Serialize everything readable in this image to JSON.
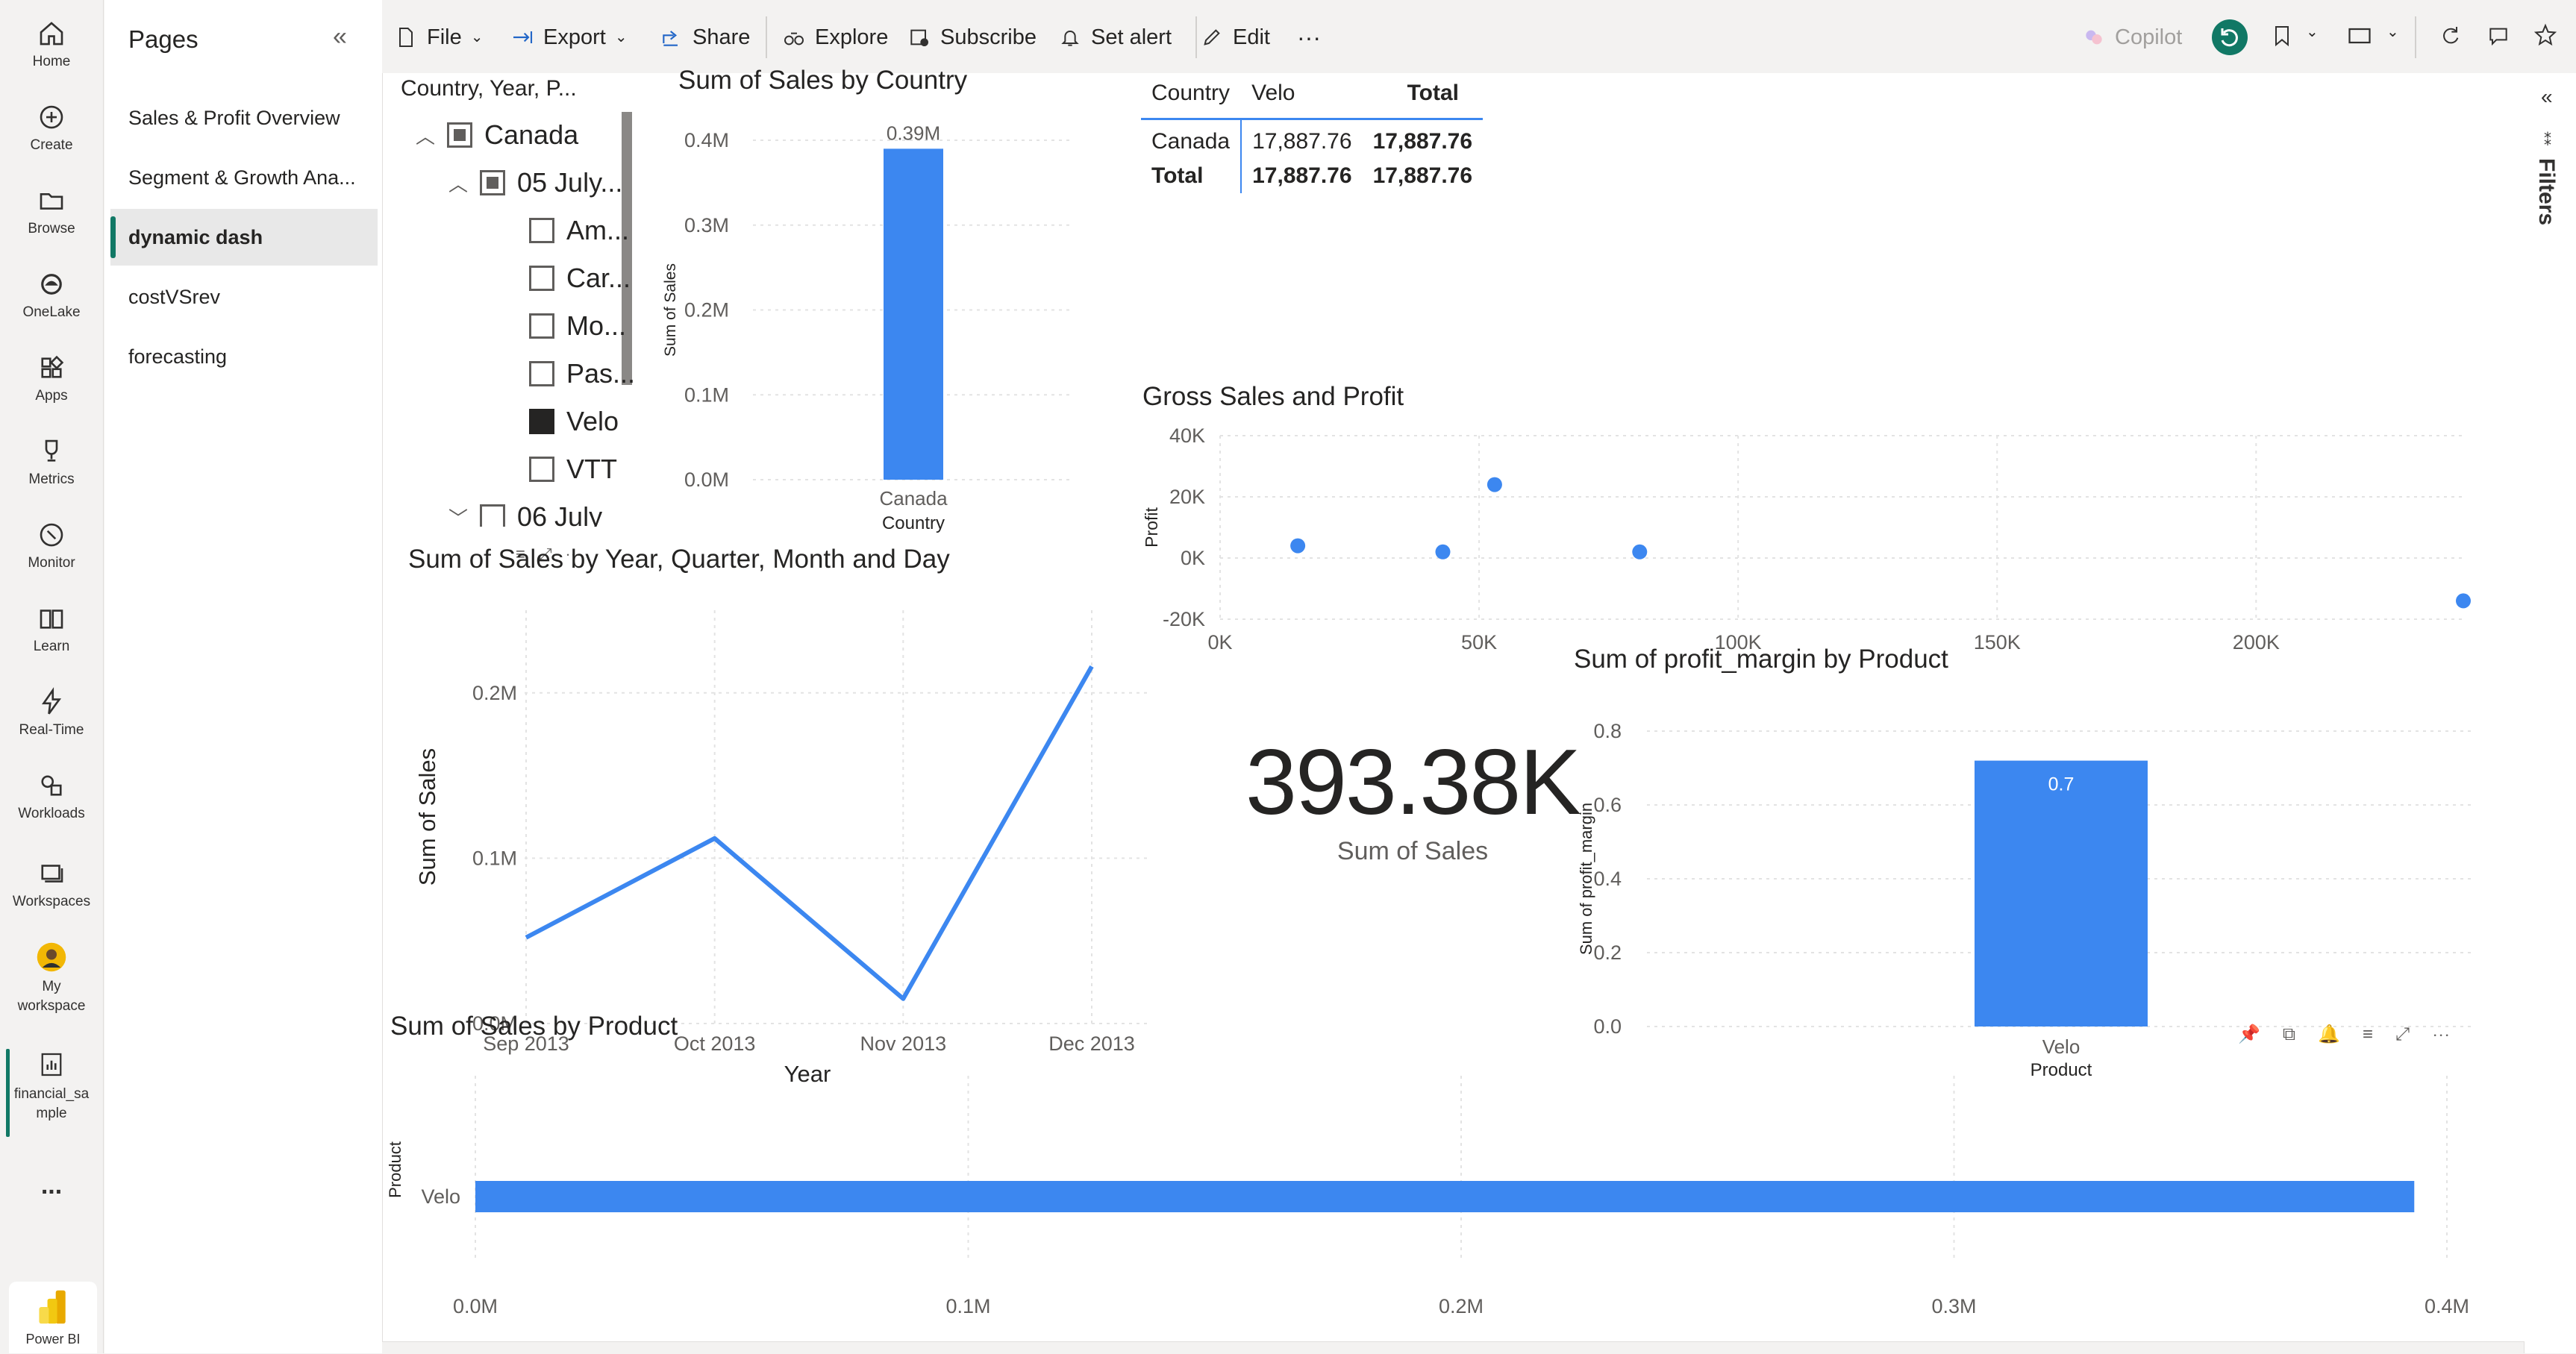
{
  "rail": {
    "items": [
      {
        "label": "Home"
      },
      {
        "label": "Create"
      },
      {
        "label": "Browse"
      },
      {
        "label": "OneLake"
      },
      {
        "label": "Apps"
      },
      {
        "label": "Metrics"
      },
      {
        "label": "Monitor"
      },
      {
        "label": "Learn"
      },
      {
        "label": "Real-Time"
      },
      {
        "label": "Workloads"
      },
      {
        "label": "Workspaces"
      },
      {
        "label": "My workspace"
      },
      {
        "label": "financial_sample"
      }
    ],
    "more": "...",
    "brand": "Power BI"
  },
  "pages": {
    "title": "Pages",
    "items": [
      {
        "label": "Sales & Profit Overview"
      },
      {
        "label": "Segment & Growth Ana..."
      },
      {
        "label": "dynamic dash"
      },
      {
        "label": "costVSrev"
      },
      {
        "label": "forecasting"
      }
    ]
  },
  "toolbar": {
    "file": "File",
    "export": "Export",
    "share": "Share",
    "explore": "Explore",
    "subscribe": "Subscribe",
    "set_alert": "Set alert",
    "edit": "Edit",
    "more": "···",
    "copilot": "Copilot"
  },
  "filters_label": "Filters",
  "slicer": {
    "header": "Country, Year, P...",
    "rows": [
      {
        "label": "Canada"
      },
      {
        "label": "05 July..."
      },
      {
        "label": "Am..."
      },
      {
        "label": "Car..."
      },
      {
        "label": "Mo..."
      },
      {
        "label": "Pas..."
      },
      {
        "label": "Velo"
      },
      {
        "label": "VTT"
      },
      {
        "label": "06 July"
      }
    ]
  },
  "matrix": {
    "headers": [
      "Country",
      "Velo",
      "Total"
    ],
    "rows": [
      [
        "Canada",
        "17,887.76",
        "17,887.76"
      ],
      [
        "Total",
        "17,887.76",
        "17,887.76"
      ]
    ]
  },
  "card": {
    "value": "393.38K",
    "label": "Sum of  Sales"
  },
  "chart_data": [
    {
      "type": "bar",
      "title": "Sum of Sales by Country",
      "categories": [
        "Canada"
      ],
      "values": [
        390000
      ],
      "data_labels": [
        "0.39M"
      ],
      "xlabel": "Country",
      "ylabel": "Sum of Sales",
      "yticks": [
        "0.0M",
        "0.1M",
        "0.2M",
        "0.3M",
        "0.4M"
      ],
      "ylim": [
        0,
        400000
      ],
      "color": "#3c87f0"
    },
    {
      "type": "scatter",
      "title": "Gross Sales and Profit",
      "ylabel": "Profit",
      "xticks": [
        "0K",
        "50K",
        "100K",
        "150K",
        "200K"
      ],
      "yticks": [
        "-20K",
        "0K",
        "20K",
        "40K"
      ],
      "xlim": [
        0,
        240000
      ],
      "ylim": [
        -20000,
        40000
      ],
      "x": [
        15000,
        43000,
        53000,
        81000,
        240000
      ],
      "y": [
        4000,
        2000,
        24000,
        2000,
        -14000
      ],
      "color": "#3c87f0"
    },
    {
      "type": "line",
      "title": "Sum of Sales by Year, Quarter, Month and Day",
      "categories": [
        "Sep 2013",
        "Oct 2013",
        "Nov 2013",
        "Dec 2013"
      ],
      "values": [
        52000,
        112000,
        15000,
        216000
      ],
      "xlabel": "Year",
      "ylabel": "Sum of Sales",
      "yticks": [
        "0.0M",
        "0.1M",
        "0.2M"
      ],
      "ylim": [
        0,
        250000
      ],
      "color": "#3c87f0"
    },
    {
      "type": "bar",
      "title": "Sum of profit_margin by Product",
      "categories": [
        "Velo"
      ],
      "values": [
        0.72
      ],
      "data_labels": [
        "0.7"
      ],
      "xlabel": "Product",
      "ylabel": "Sum of profit_margin",
      "yticks": [
        "0.0",
        "0.2",
        "0.4",
        "0.6",
        "0.8"
      ],
      "ylim": [
        0,
        0.8
      ],
      "color": "#3c87f0"
    },
    {
      "type": "bar",
      "orientation": "horizontal",
      "title": "Sum of Sales by Product",
      "categories": [
        "Velo"
      ],
      "values": [
        393380
      ],
      "ylabel": "Product",
      "xticks": [
        "0.0M",
        "0.1M",
        "0.2M",
        "0.3M",
        "0.4M"
      ],
      "xlim": [
        0,
        400000
      ],
      "color": "#3c87f0"
    }
  ]
}
